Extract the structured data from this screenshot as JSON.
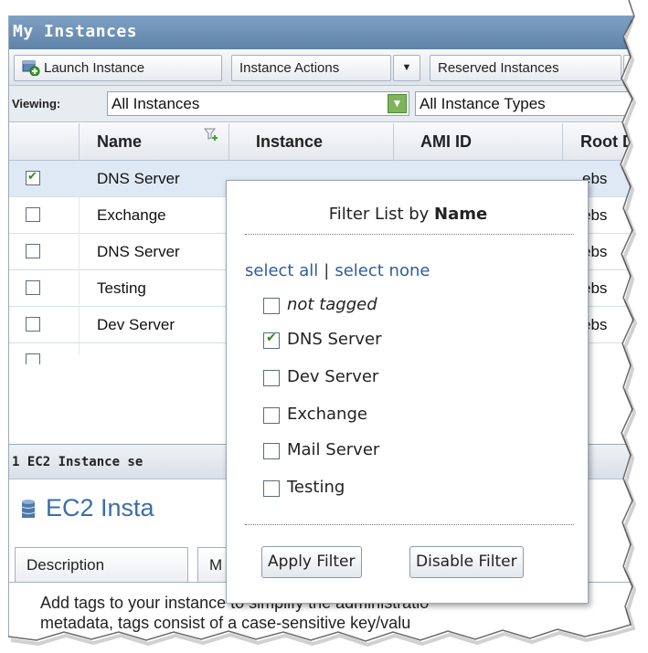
{
  "panel": {
    "title": "My Instances"
  },
  "toolbar": {
    "launch_label": "Launch Instance",
    "actions_label": "Instance Actions",
    "reserved_label": "Reserved Instances"
  },
  "viewing": {
    "label": "Viewing:",
    "instances_value": "All Instances",
    "types_value": "All Instance Types"
  },
  "grid": {
    "columns": [
      "Name",
      "Instance",
      "AMI ID",
      "Root D"
    ],
    "rows": [
      {
        "name": "DNS Server",
        "root": "ebs",
        "checked": true
      },
      {
        "name": "Exchange",
        "root": "ebs",
        "checked": false
      },
      {
        "name": "DNS Server",
        "root": "ebs",
        "checked": false
      },
      {
        "name": "Testing",
        "root": "ebs",
        "checked": false
      },
      {
        "name": "Dev Server",
        "root": "ebs",
        "checked": false
      }
    ]
  },
  "lower": {
    "selection_text": "1 EC2 Instance se",
    "title": "EC2 Insta",
    "tabs": [
      "Description",
      "M"
    ],
    "desc_line1": "Add tags to your instance to simplify the administratio",
    "desc_line2": "metadata, tags consist of a case-sensitive key/valu"
  },
  "filter_popup": {
    "title_prefix": "Filter List by ",
    "title_field": "Name",
    "select_all": "select all",
    "separator": "|",
    "select_none": "select none",
    "options": [
      {
        "label": "not tagged",
        "checked": false,
        "italic": true
      },
      {
        "label": "DNS Server",
        "checked": true,
        "italic": false
      },
      {
        "label": "Dev Server",
        "checked": false,
        "italic": false
      },
      {
        "label": "Exchange",
        "checked": false,
        "italic": false
      },
      {
        "label": "Mail Server",
        "checked": false,
        "italic": false
      },
      {
        "label": "Testing",
        "checked": false,
        "italic": false
      }
    ],
    "apply_label": "Apply Filter",
    "disable_label": "Disable Filter"
  },
  "colors": {
    "titlebar": "#6f92b8",
    "link": "#2f5d9c",
    "selected_row": "#dfe9f6",
    "check": "#2e8b1f"
  },
  "icons": [
    "launch-instance-icon",
    "dropdown-caret-icon",
    "filter-icon",
    "checkbox-icon",
    "database-icon"
  ]
}
